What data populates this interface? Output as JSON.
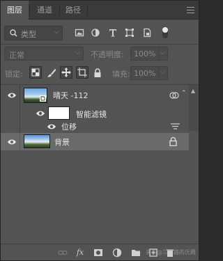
{
  "tabs": [
    {
      "label": "图层",
      "active": true
    },
    {
      "label": "通道",
      "active": false
    },
    {
      "label": "路径",
      "active": false
    }
  ],
  "filter": {
    "kind_label": "类型",
    "icons": [
      "image-filter-icon",
      "adjustment-filter-icon",
      "type-filter-icon",
      "shape-filter-icon",
      "smart-object-filter-icon",
      "filter-toggle"
    ]
  },
  "blend": {
    "mode": "正常",
    "opacity_label": "不透明度:",
    "opacity_value": "100%"
  },
  "lock": {
    "label": "锁定:",
    "fill_label": "填充:",
    "fill_value": "100%"
  },
  "layers": [
    {
      "name": "晴天 -112",
      "type": "smart-object"
    },
    {
      "name": "智能滤镜",
      "type": "smart-filter"
    },
    {
      "name": "位移",
      "type": "filter"
    },
    {
      "name": "背景",
      "type": "background",
      "selected": true
    }
  ],
  "bottom": {
    "watermark": "头条@三岔路的氏霞"
  },
  "colors": {
    "panel_bg": "#535353",
    "tab_bar_bg": "#3a3a3a",
    "selected_row": "#6a6a6a",
    "text": "#e4e4e4"
  }
}
